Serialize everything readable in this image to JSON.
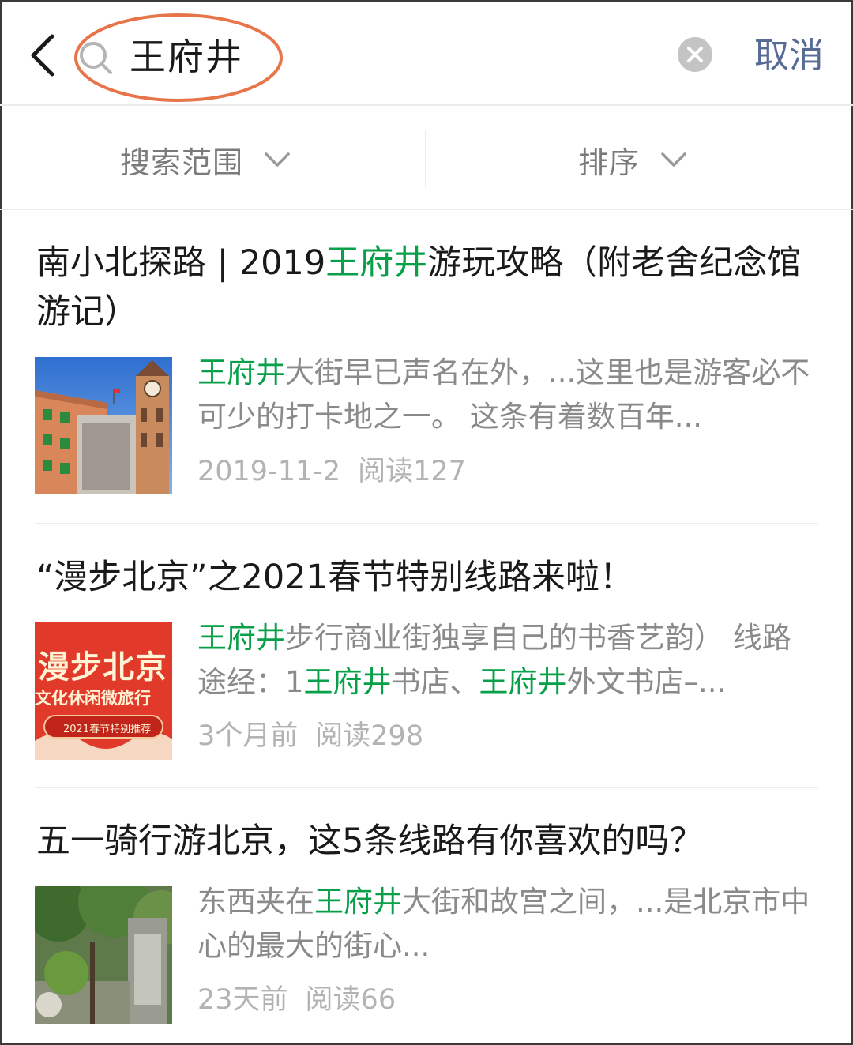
{
  "search": {
    "query": "王府井",
    "cancel_label": "取消"
  },
  "filters": {
    "range_label": "搜索范围",
    "sort_label": "排序"
  },
  "colors": {
    "highlight": "#07a048",
    "link": "#576b95",
    "annotation_ring": "#e8744a"
  },
  "results": [
    {
      "title_parts": [
        "南小北探路 | 2019",
        "王府井",
        "游玩攻略（附老舍纪念馆游记）"
      ],
      "snippet_parts": [
        "王府井",
        "大街早已声名在外，...这里也是游客必不可少的打卡地之一。 这条有着数百年..."
      ],
      "date": "2019-11-2",
      "reads": "阅读127",
      "thumb": "clock-tower-building-photo"
    },
    {
      "title_parts": [
        "“漫步北京”之2021春节特别线路来啦！"
      ],
      "snippet_parts": [
        "王府井",
        "步行商业街独享自己的书香艺韵） 线路途经：1",
        "王府井",
        "书店、",
        "王府井",
        "外文书店–..."
      ],
      "date": "3个月前",
      "reads": "阅读298",
      "thumb_text": {
        "line1": "漫步北京",
        "line2": "文化休闲微旅行",
        "line3": "2021春节特别推荐"
      }
    },
    {
      "title_parts": [
        "五一骑行游北京，这5条线路有你喜欢的吗？"
      ],
      "snippet_parts": [
        "东西夹在",
        "王府井",
        "大街和故宫之间，...是北京市中心的最大的街心..."
      ],
      "date": "23天前",
      "reads": "阅读66",
      "thumb": "tree-lined-courtyard-photo"
    }
  ]
}
